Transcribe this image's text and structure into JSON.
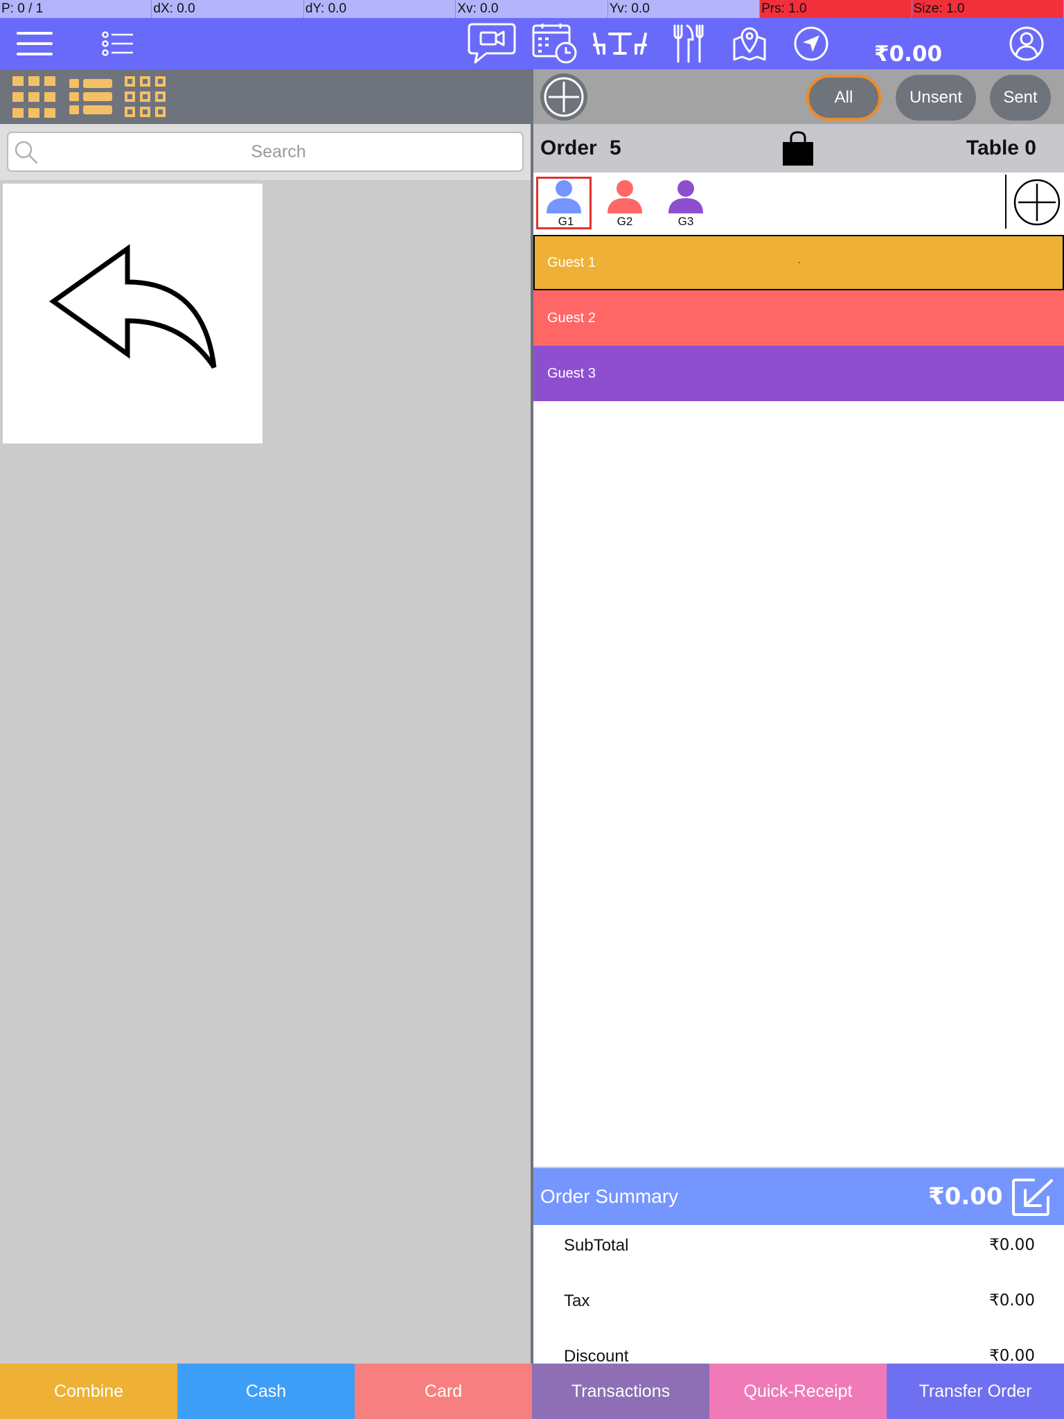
{
  "debug": {
    "pointer": "P: 0 / 1",
    "dx": "dX: 0.0",
    "dy": "dY: 0.0",
    "xv": "Xv: 0.0",
    "yv": "Yv: 0.0",
    "prs": "Prs: 1.0",
    "size": "Size: 1.0"
  },
  "header": {
    "balance": "₹0.00",
    "icons": [
      "menu-icon",
      "list-icon",
      "video-chat-icon",
      "calendar-clock-icon",
      "tables-icon",
      "cutlery-icon",
      "map-pin-icon",
      "navigation-icon",
      "profile-icon"
    ]
  },
  "search": {
    "placeholder": "Search"
  },
  "filters": {
    "all": "All",
    "unsent": "Unsent",
    "sent": "Sent"
  },
  "order": {
    "label": "Order",
    "number": "5",
    "table": "Table 0"
  },
  "guest_chips": [
    {
      "label": "G1",
      "color": "#7596ff"
    },
    {
      "label": "G2",
      "color": "#ff6666"
    },
    {
      "label": "G3",
      "color": "#8e4fcf"
    }
  ],
  "guests": [
    {
      "label": "Guest 1",
      "color": "#eeb135"
    },
    {
      "label": "Guest 2",
      "color": "#ff6666"
    },
    {
      "label": "Guest 3",
      "color": "#8e4fcf"
    }
  ],
  "summary": {
    "title": "Order Summary",
    "total": "₹0.00",
    "rows": [
      {
        "label": "SubTotal",
        "value": "₹0.00"
      },
      {
        "label": "Tax",
        "value": "₹0.00"
      },
      {
        "label": "Discount",
        "value": "₹0.00"
      }
    ]
  },
  "actions": {
    "combine": "Combine",
    "cash": "Cash",
    "card": "Card",
    "transactions": "Transactions",
    "quick_receipt": "Quick-Receipt",
    "transfer_order": "Transfer Order"
  },
  "colors": {
    "topbar": "#6a6afa",
    "combine": "#eeb135",
    "cash": "#3d9ff7",
    "card": "#f77f7f",
    "transactions": "#8e6fb5",
    "quick_receipt": "#f07ab8",
    "transfer_order": "#6f6ff2"
  }
}
